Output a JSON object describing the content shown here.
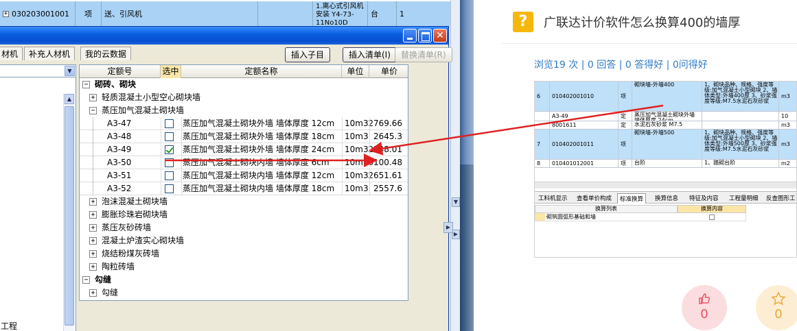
{
  "bg_sheet": {
    "code": "030203001001",
    "unit_type": "项",
    "name": "送、引风机",
    "desc": "1.离心式引风机安装 Y4-73-11No10D",
    "unit": "台",
    "qty": "1"
  },
  "dialog": {
    "tabs": [
      "材机",
      "补充人材机",
      "我的云数据"
    ],
    "buttons": {
      "insert_child": "插入子目",
      "insert_list": "插入清单(I)",
      "replace_list": "替换清单(R)"
    },
    "left_item": "工程",
    "table": {
      "headers": [
        "定额号",
        "选中",
        "定额名称",
        "单位",
        "单价"
      ],
      "rows": [
        {
          "kind": "group",
          "text": "砌砖、砌块",
          "sign": "−"
        },
        {
          "kind": "sub",
          "text": "轻质混凝土小型空心砌块墙",
          "sign": "+"
        },
        {
          "kind": "sub",
          "text": "蒸压加气混凝土砌块墙",
          "sign": "−"
        },
        {
          "kind": "item",
          "code": "A3-47",
          "checked": false,
          "name": "蒸压加气混凝土砌块外墙 墙体厚度 12cm",
          "unit": "10m3",
          "price": "2769.66"
        },
        {
          "kind": "item",
          "code": "A3-48",
          "checked": false,
          "name": "蒸压加气混凝土砌块外墙 墙体厚度 18cm",
          "unit": "10m3",
          "price": "2645.3"
        },
        {
          "kind": "item",
          "code": "A3-49",
          "checked": true,
          "name": "蒸压加气混凝土砌块外墙 墙体厚度 24cm",
          "unit": "10m3",
          "price": "2548.01"
        },
        {
          "kind": "item",
          "code": "A3-50",
          "checked": false,
          "name": "蒸压加气混凝土砌块内墙 墙体厚度 6cm",
          "unit": "10m3",
          "price": "3100.48"
        },
        {
          "kind": "item",
          "code": "A3-51",
          "checked": false,
          "name": "蒸压加气混凝土砌块内墙 墙体厚度 12cm",
          "unit": "10m3",
          "price": "2651.61"
        },
        {
          "kind": "item",
          "code": "A3-52",
          "checked": false,
          "name": "蒸压加气混凝土砌块内墙 墙体厚度 18cm",
          "unit": "10m3",
          "price": "2557.6"
        },
        {
          "kind": "sub",
          "text": "泡沫混凝土砌块墙",
          "sign": "+"
        },
        {
          "kind": "sub",
          "text": "膨胀珍珠岩砌块墙",
          "sign": "+"
        },
        {
          "kind": "sub",
          "text": "蒸压灰砂砖墙",
          "sign": "+"
        },
        {
          "kind": "sub",
          "text": "混凝土炉渣实心砌块墙",
          "sign": "+"
        },
        {
          "kind": "sub",
          "text": "烧结粉煤灰砖墙",
          "sign": "+"
        },
        {
          "kind": "sub",
          "text": "陶粒砖墙",
          "sign": "+"
        },
        {
          "kind": "group",
          "text": "勾缝",
          "sign": "−"
        },
        {
          "kind": "sub",
          "text": "勾缝",
          "sign": "+"
        }
      ]
    }
  },
  "question": {
    "title": "广联达计价软件怎么换算400的墙厚",
    "stats": "浏览19 次 | 0 回答 | 0 答得好 | 0问得好"
  },
  "shot": {
    "rows": [
      {
        "no": "6",
        "code": "010402001010",
        "type": "项",
        "name": "砌块墙-外墙400",
        "desc": "1、砌块品种、规格、强度等级:加气混凝土小型砌块 2、墙体类型:外墙400厚 3、砂浆强度等级:M7.5水泥石灰砂浆",
        "unit": "m3"
      },
      {
        "no": "",
        "code": "A3-49",
        "type": "定",
        "name": "蒸压加气混凝土砌块外墙 墙体厚度 24cm",
        "desc": "",
        "unit": "10"
      },
      {
        "no": "",
        "code": "8001611",
        "type": "定",
        "name": "水泥石灰砂浆 M7.5",
        "desc": "",
        "unit": "m3"
      },
      {
        "no": "7",
        "code": "010402001011",
        "type": "项",
        "name": "砌块墙-外墙500",
        "desc": "1、砌块品种、规格、强度等级:加气混凝土小型砌块 2、墙体类型:外墙500厚 3、砂浆强度等级:M7.5水泥石灰砂浆",
        "unit": "m3"
      },
      {
        "no": "8",
        "code": "010401012001",
        "type": "项",
        "name": "台阶",
        "desc": "1、踏砌台阶",
        "unit": "m2"
      }
    ],
    "tabs": [
      "工料机显示",
      "查看单价构成",
      "标准换算",
      "换算信息",
      "特征及内容",
      "工程量明细",
      "反查图形工"
    ],
    "active_tab": "标准换算",
    "head": [
      "换算列表",
      "换算内容"
    ],
    "list_item": "砌筑圆弧形基础和墙"
  },
  "likes": {
    "up_count": "0",
    "star_count": "0"
  },
  "colors": {
    "accent_blue": "#2f7ac5",
    "arrow_red": "#e02020",
    "icon_yellow": "#f6b70d"
  }
}
